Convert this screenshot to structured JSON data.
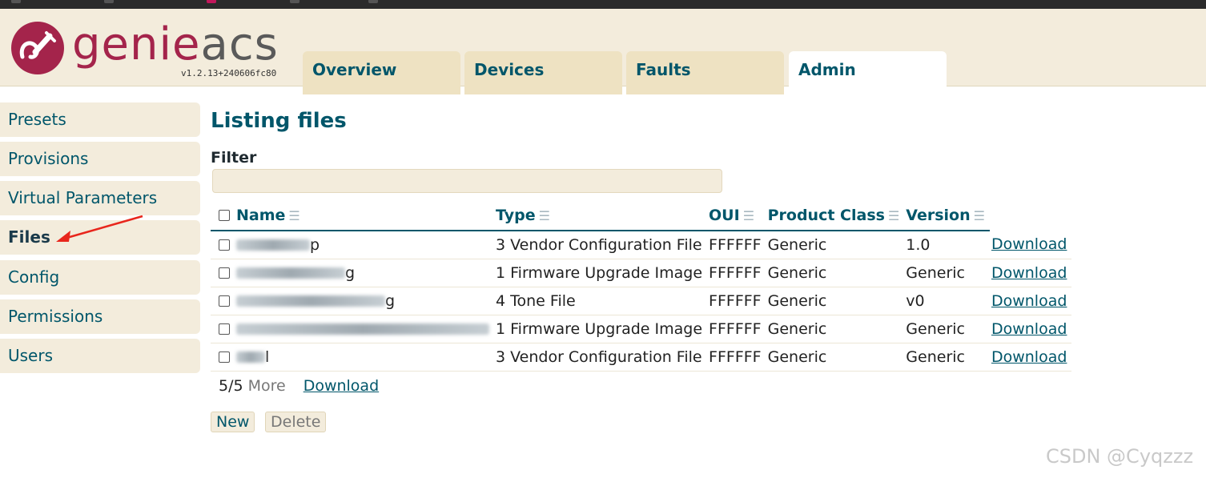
{
  "app": {
    "logo_genie": "genie",
    "logo_acs": "acs",
    "version": "v1.2.13+240606fc80",
    "brand_color": "#a4244b",
    "accent_color": "#00566a"
  },
  "tabs": [
    {
      "label": "Overview"
    },
    {
      "label": "Devices"
    },
    {
      "label": "Faults"
    },
    {
      "label": "Admin"
    }
  ],
  "sidebar": {
    "items": [
      {
        "label": "Presets"
      },
      {
        "label": "Provisions"
      },
      {
        "label": "Virtual Parameters"
      },
      {
        "label": "Files"
      },
      {
        "label": "Config"
      },
      {
        "label": "Permissions"
      },
      {
        "label": "Users"
      }
    ]
  },
  "main": {
    "title": "Listing files",
    "filter_label": "Filter",
    "filter_value": "",
    "columns": [
      "Name",
      "Type",
      "OUI",
      "Product Class",
      "Version"
    ],
    "rows": [
      {
        "name_tail": "p",
        "type": "3 Vendor Configuration File",
        "oui": "FFFFFF",
        "product_class": "Generic",
        "version": "1.0",
        "action": "Download"
      },
      {
        "name_tail": "g",
        "type": "1 Firmware Upgrade Image",
        "oui": "FFFFFF",
        "product_class": "Generic",
        "version": "Generic",
        "action": "Download"
      },
      {
        "name_tail": "g",
        "type": "4 Tone File",
        "oui": "FFFFFF",
        "product_class": "Generic",
        "version": "v0",
        "action": "Download"
      },
      {
        "name_tail": "",
        "type": "1 Firmware Upgrade Image",
        "oui": "FFFFFF",
        "product_class": "Generic",
        "version": "Generic",
        "action": "Download"
      },
      {
        "name_tail": "l",
        "type": "3 Vendor Configuration File",
        "oui": "FFFFFF",
        "product_class": "Generic",
        "version": "Generic",
        "action": "Download"
      }
    ],
    "count": "5/5",
    "more_label": "More",
    "download_all_label": "Download",
    "new_label": "New",
    "delete_label": "Delete"
  },
  "icons": {
    "sort": "sort-icon",
    "arrow": "red-arrow-annotation-icon"
  },
  "watermark": "CSDN @Cyqzzz"
}
